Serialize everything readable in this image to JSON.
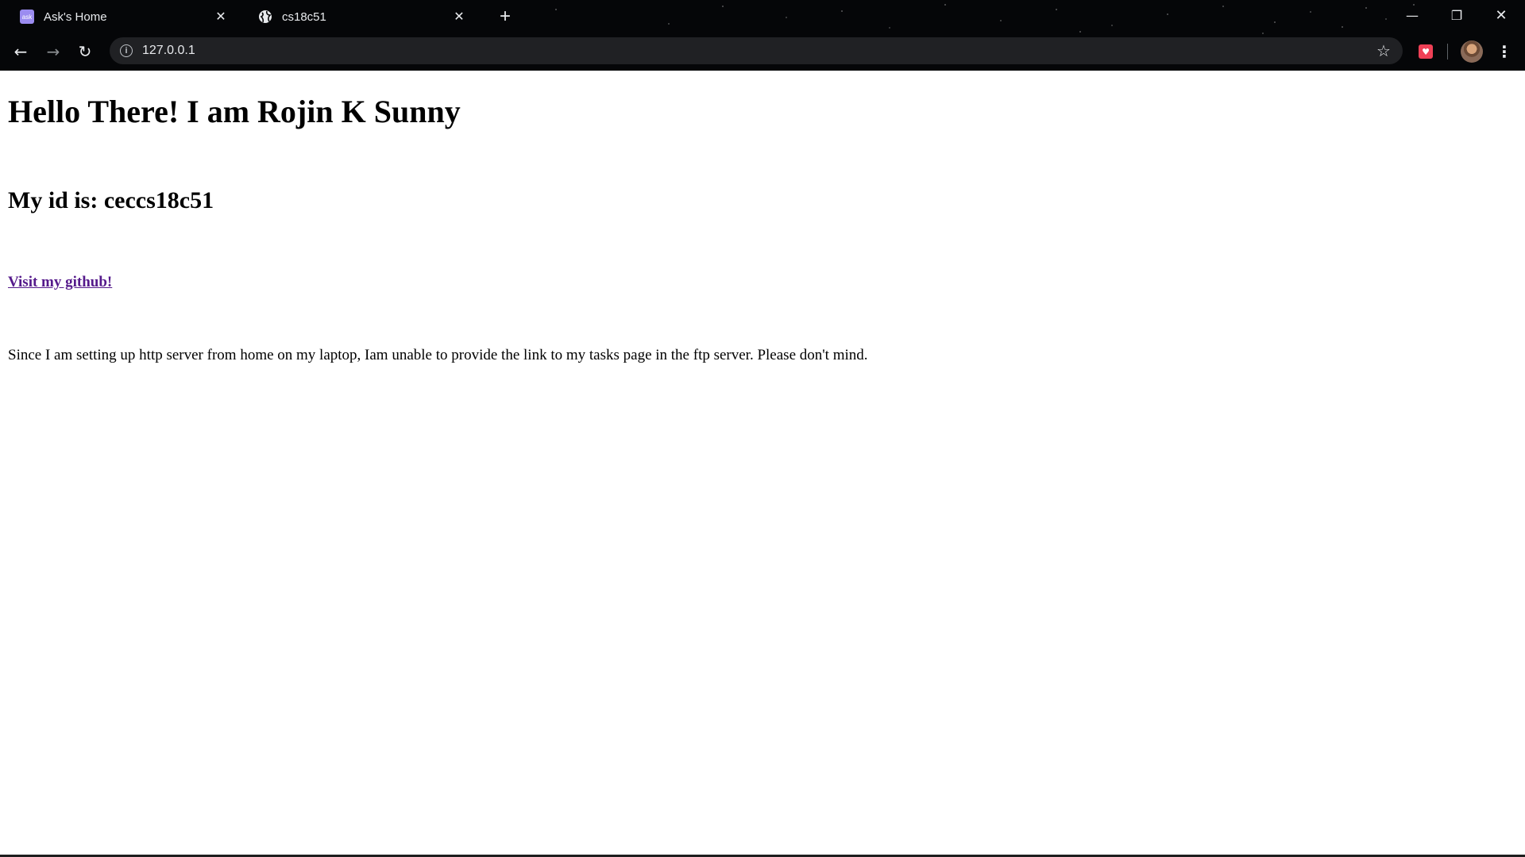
{
  "browser": {
    "tabs": [
      {
        "title": "Ask's Home",
        "favicon": "ask-logo",
        "favicon_text": "ask",
        "active": false
      },
      {
        "title": "cs18c51",
        "favicon": "globe-icon",
        "active": true
      }
    ],
    "new_tab_glyph": "+",
    "window_controls": {
      "minimize": "—",
      "maximize": "❐",
      "close": "✕"
    },
    "toolbar": {
      "back_glyph": "←",
      "forward_glyph": "→",
      "reload_glyph": "↻",
      "info_glyph": "i",
      "url": "127.0.0.1",
      "bookmark_glyph": "☆",
      "extension_glyph": "♥",
      "menu_glyph": "⋮"
    }
  },
  "page": {
    "heading": "Hello There! I am Rojin K Sunny",
    "subheading": "My id is: ceccs18c51",
    "github_link": "Visit my github!",
    "note": "Since I am setting up http server from home on my laptop, Iam unable to provide the link to my tasks page in the ftp server. Please don't mind."
  },
  "colors": {
    "chrome_bg": "#050608",
    "omnibox_bg": "#202124",
    "chrome_text": "#e8eaed",
    "visited_link": "#551a8b",
    "page_bg": "#ffffff"
  }
}
